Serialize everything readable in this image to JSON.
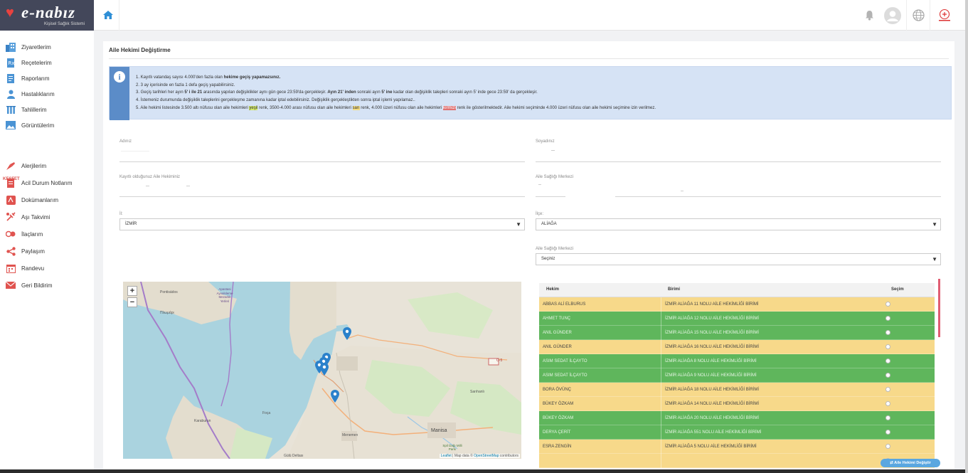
{
  "brand": {
    "title": "e-nabız",
    "subtitle": "Kişisel Sağlık Sistemi"
  },
  "colors": {
    "sidebar_dark": "#43475a",
    "accent_blue": "#5aa7e0",
    "row_yellow": "#f7d98a",
    "row_green": "#5fb65c",
    "kesfet": "#d9534f"
  },
  "sidebar": {
    "items": [
      {
        "label": "Ziyaretlerim",
        "icon": "hospital-icon"
      },
      {
        "label": "Reçetelerim",
        "icon": "prescription-icon"
      },
      {
        "label": "Raporlarım",
        "icon": "report-icon"
      },
      {
        "label": "Hastalıklarım",
        "icon": "patient-icon"
      },
      {
        "label": "Tahlillerim",
        "icon": "test-tube-icon"
      },
      {
        "label": "Görüntülerim",
        "icon": "image-icon"
      }
    ],
    "section": "KEŞFET",
    "explore": [
      {
        "label": "Alerjilerim",
        "icon": "allergy-icon"
      },
      {
        "label": "Acil Durum Notlarım",
        "icon": "emergency-note-icon"
      },
      {
        "label": "Dokümanlarım",
        "icon": "document-icon"
      },
      {
        "label": "Aşı Takvimi",
        "icon": "vaccine-icon"
      },
      {
        "label": "İlaçlarım",
        "icon": "pill-icon"
      },
      {
        "label": "Paylaşım",
        "icon": "share-icon"
      },
      {
        "label": "Randevu",
        "icon": "calendar-icon"
      },
      {
        "label": "Geri Bildirim",
        "icon": "mail-icon"
      }
    ]
  },
  "panel": {
    "title": "Aile Hekimi Değiştirme"
  },
  "info": {
    "l1a": "1. Kayıtlı vatandaş sayısı 4.000'den fazla olan ",
    "l1b": "hekime geçiş yapamazsınız.",
    "l2": "2. 3 ay içerisinde en fazla 1 defa geçiş yapabilirsiniz.",
    "l3a": "3. Geçiş tarihleri her ayın ",
    "l3b": "5' i ile 21",
    "l3c": " arasında yapılan değişiklikler aynı gün gece 23:59'da gerçekleşir. ",
    "l3d": "Ayın 21' inden",
    "l3e": " sonraki ayın ",
    "l3f": "5' ine",
    "l3g": " kadar olan değişiklik talepleri sonraki ayın 5' inde gece 23:59' da gerçekleşir.",
    "l4": "4. İstemeniz durumunda değişiklik taleplerini gerçekleşme zamanına kadar iptal edebilirsiniz. Değişiklik gerçekleştikten sonra iptal işlemi yapılamaz..",
    "l5a": "5. Aile hekimi listesinde 3.500 altı nüfusu olan aile hekimleri ",
    "l5b": "yeşil",
    "l5c": " renk, 3500-4.000 arası nüfusu olan aile hekimleri ",
    "l5d": "sarı",
    "l5e": " renk, 4.000 üzeri nüfusu olan aile hekimleri ",
    "l5f": "kırmızı",
    "l5g": " renk ile gösterilmektedir. Aile hekimi seçiminde 4.000 üzeri nüfusu olan aile hekimi seçimine izin verilmez."
  },
  "form": {
    "name_label": "Adınız",
    "surname_label": "Soyadınız",
    "doctor_label": "Kayıtlı olduğunuz Aile Hekiminiz",
    "center_label": "Aile Sağlığı Merkezi",
    "il_label": "İl:",
    "il_value": "İZMİR",
    "ilce_label": "İlçe:",
    "ilce_value": "ALİAĞA",
    "asm_label": "Aile Sağlığı Merkezi",
    "asm_value": "Seçiniz"
  },
  "map": {
    "zoom_in": "+",
    "zoom_out": "−",
    "places": {
      "p1": "Pontisádos",
      "p2": "Πλωμάρι",
      "p3": "Apastasi Ayvalsleme Mezarlık Yerleri",
      "p4": "Foça",
      "p5": "Karaburun",
      "p6": "Menemen",
      "p7": "Manisa",
      "p8": "Sarıhanlı",
      "p9": "Spil Dağı Milli Parkı",
      "p10": "Gülü Deltası"
    },
    "attr_leaflet": "Leaflet",
    "attr_text": " | Map data © ",
    "attr_osm": "OpenStreetMap",
    "attr_tail": " contributors",
    "road_badge": "O-5"
  },
  "table": {
    "headers": [
      "Hekim",
      "Birimi",
      "Seçim"
    ],
    "rows": [
      {
        "doctor": "ABBAS ALİ ELBURUS",
        "unit": "İZMİR ALİAĞA 11 NOLU AİLE HEKİMLİĞİ BİRİMİ",
        "status": "yellow"
      },
      {
        "doctor": "AHMET TUNÇ",
        "unit": "İZMİR ALİAĞA 12 NOLU AİLE HEKİMLİĞİ BİRİMİ",
        "status": "green"
      },
      {
        "doctor": "ANIL GÜNDER",
        "unit": "İZMİR ALİAĞA 15 NOLU AİLE HEKİMLİĞİ BİRİMİ",
        "status": "green"
      },
      {
        "doctor": "ANIL GÜNDER",
        "unit": "İZMİR ALİAĞA 16 NOLU AİLE HEKİMLİĞİ BİRİMİ",
        "status": "yellow"
      },
      {
        "doctor": "ASIM SEDAT İLÇAYTO",
        "unit": "İZMİR ALİAĞA 8 NOLU AİLE HEKİMLİĞİ BİRİMİ",
        "status": "green"
      },
      {
        "doctor": "ASIM SEDAT İLÇAYTO",
        "unit": "İZMİR ALİAĞA 9 NOLU AİLE HEKİMLİĞİ BİRİMİ",
        "status": "green"
      },
      {
        "doctor": "BORA ÖVÜNÇ",
        "unit": "İZMİR ALİAĞA 18 NOLU AİLE HEKİMLİĞİ BİRİMİ",
        "status": "yellow"
      },
      {
        "doctor": "BÜKEY ÖZKAM",
        "unit": "İZMİR ALİAĞA 14 NOLU AİLE HEKİMLİĞİ BİRİMİ",
        "status": "yellow"
      },
      {
        "doctor": "BÜKEY ÖZKAM",
        "unit": "İZMİR ALİAĞA 20 NOLU AİLE HEKİMLİĞİ BİRİMİ",
        "status": "green"
      },
      {
        "doctor": "DERYA ÇERİT",
        "unit": "İZMİR ALİAĞA 551 NOLU AİLE HEKİMLİĞİ BİRİMİ",
        "status": "green"
      },
      {
        "doctor": "ESRA ZENGİN",
        "unit": "İZMİR ALİAĞA 5 NOLU AİLE HEKİMLİĞİ BİRİMİ",
        "status": "yellow"
      },
      {
        "doctor": "",
        "unit": "",
        "status": "yellow"
      }
    ]
  },
  "button": {
    "change": "⇄ Aile Hekimi Değiştir"
  }
}
